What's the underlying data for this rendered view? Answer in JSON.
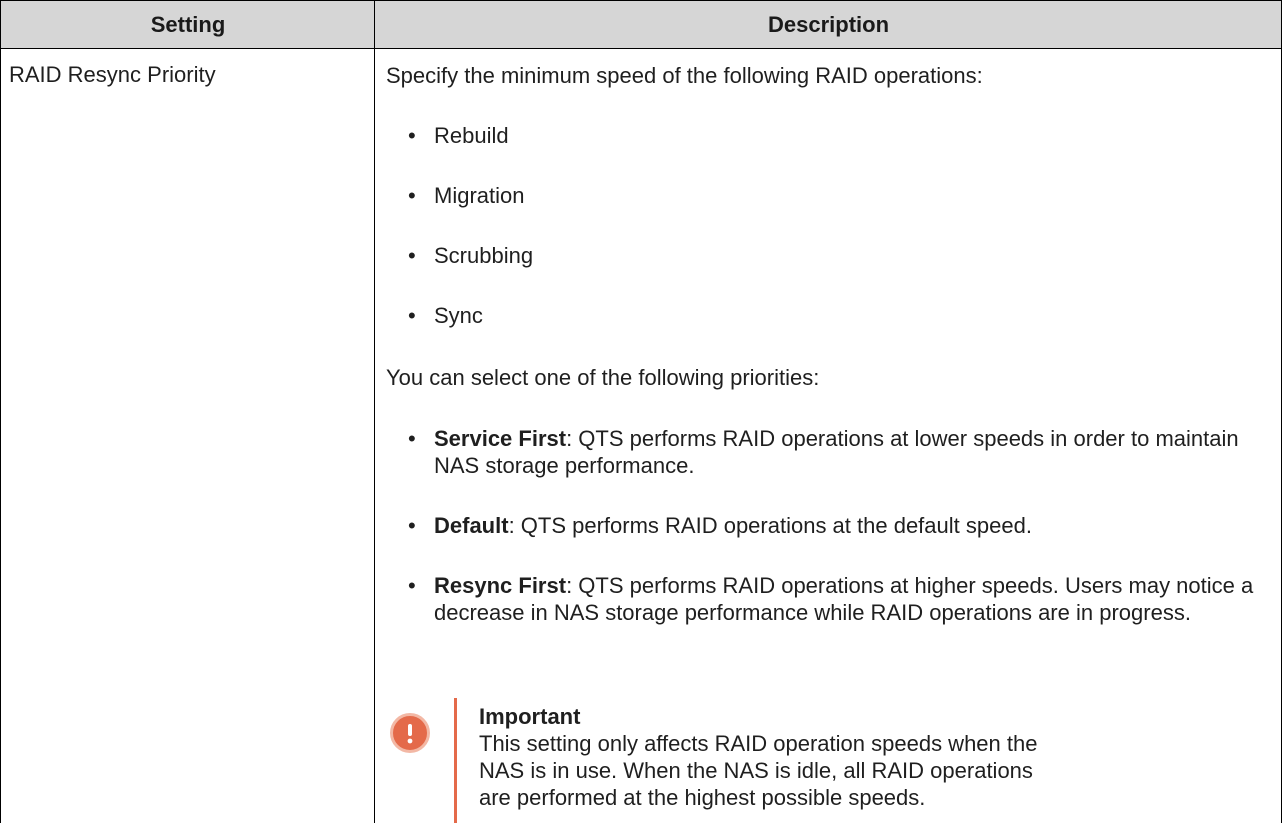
{
  "table": {
    "headers": [
      "Setting",
      "Description"
    ],
    "setting_name": "RAID Resync Priority",
    "intro": "Specify the minimum speed of the following RAID operations:",
    "operations": [
      "Rebuild",
      "Migration",
      "Scrubbing",
      "Sync"
    ],
    "priorities_intro": "You can select one of the following priorities:",
    "priorities": [
      {
        "term": "Service First",
        "desc": ": QTS performs RAID operations at lower speeds in order to maintain NAS storage performance."
      },
      {
        "term": "Default",
        "desc": ": QTS performs RAID operations at the default speed."
      },
      {
        "term": "Resync First",
        "desc": ": QTS performs RAID operations at higher speeds. Users may notice a decrease in NAS storage performance while RAID operations are in progress."
      }
    ],
    "note": {
      "icon": "important-icon",
      "title": "Important",
      "line1": "This setting only affects RAID operation speeds when the",
      "line2": "NAS is in use. When the NAS is idle, all RAID operations",
      "line3": "are performed at the highest possible speeds."
    }
  },
  "colors": {
    "header_bg": "#d6d6d6",
    "accent": "#e46a4a"
  }
}
